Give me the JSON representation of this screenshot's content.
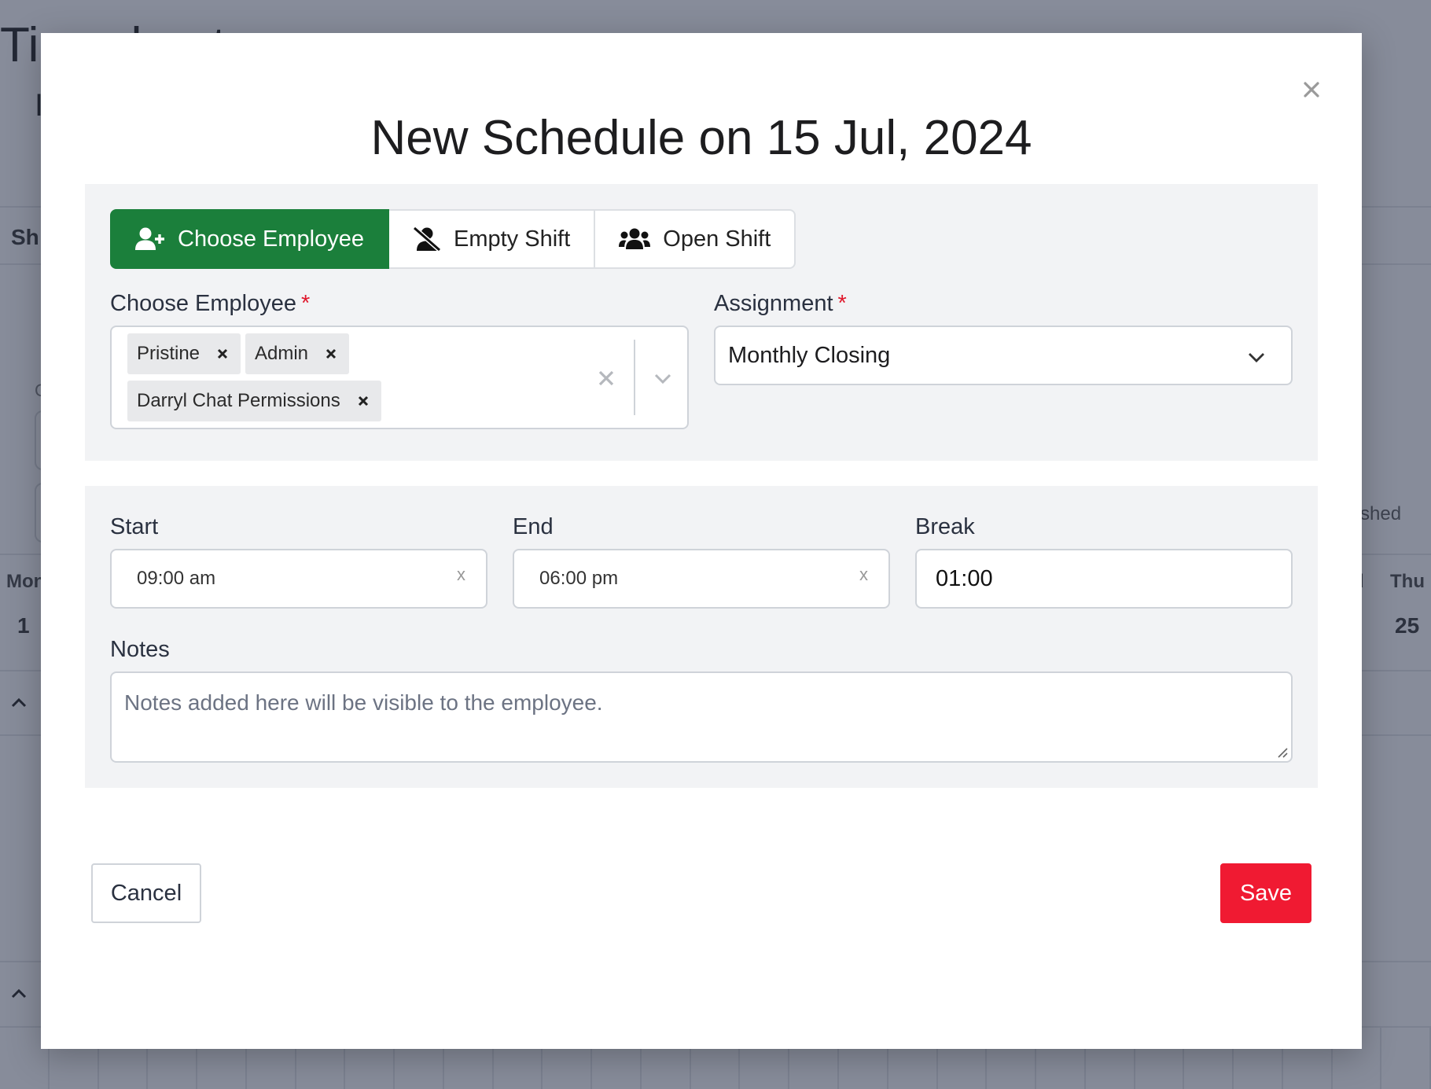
{
  "background": {
    "title": "Timesheet",
    "subtitle": "I",
    "section_label": "Sh",
    "field_hint": "C",
    "day_left": "Mon",
    "num_left": "1",
    "day_right_partial": "d",
    "day_right": "Thu",
    "num_right": "25",
    "status_partial": "shed"
  },
  "modal": {
    "title": "New Schedule on 15 Jul, 2024",
    "tabs": [
      {
        "label": "Choose Employee",
        "icon": "user-plus-icon",
        "active": true
      },
      {
        "label": "Empty Shift",
        "icon": "user-slash-icon",
        "active": false
      },
      {
        "label": "Open Shift",
        "icon": "users-icon",
        "active": false
      }
    ],
    "employee": {
      "label": "Choose Employee",
      "required_mark": "*",
      "selected": [
        "Pristine",
        "Admin",
        "Darryl Chat Permissions"
      ]
    },
    "assignment": {
      "label": "Assignment",
      "required_mark": "*",
      "value": "Monthly Closing"
    },
    "start": {
      "label": "Start",
      "value": "09:00 am",
      "clear": "x"
    },
    "end": {
      "label": "End",
      "value": "06:00 pm",
      "clear": "x"
    },
    "break": {
      "label": "Break",
      "value": "01:00"
    },
    "notes": {
      "label": "Notes",
      "placeholder": "Notes added here will be visible to the employee."
    },
    "cancel_label": "Cancel",
    "save_label": "Save"
  },
  "colors": {
    "active_tab": "#1b7f3b",
    "save_button": "#f01a32",
    "required": "#e0182c"
  }
}
